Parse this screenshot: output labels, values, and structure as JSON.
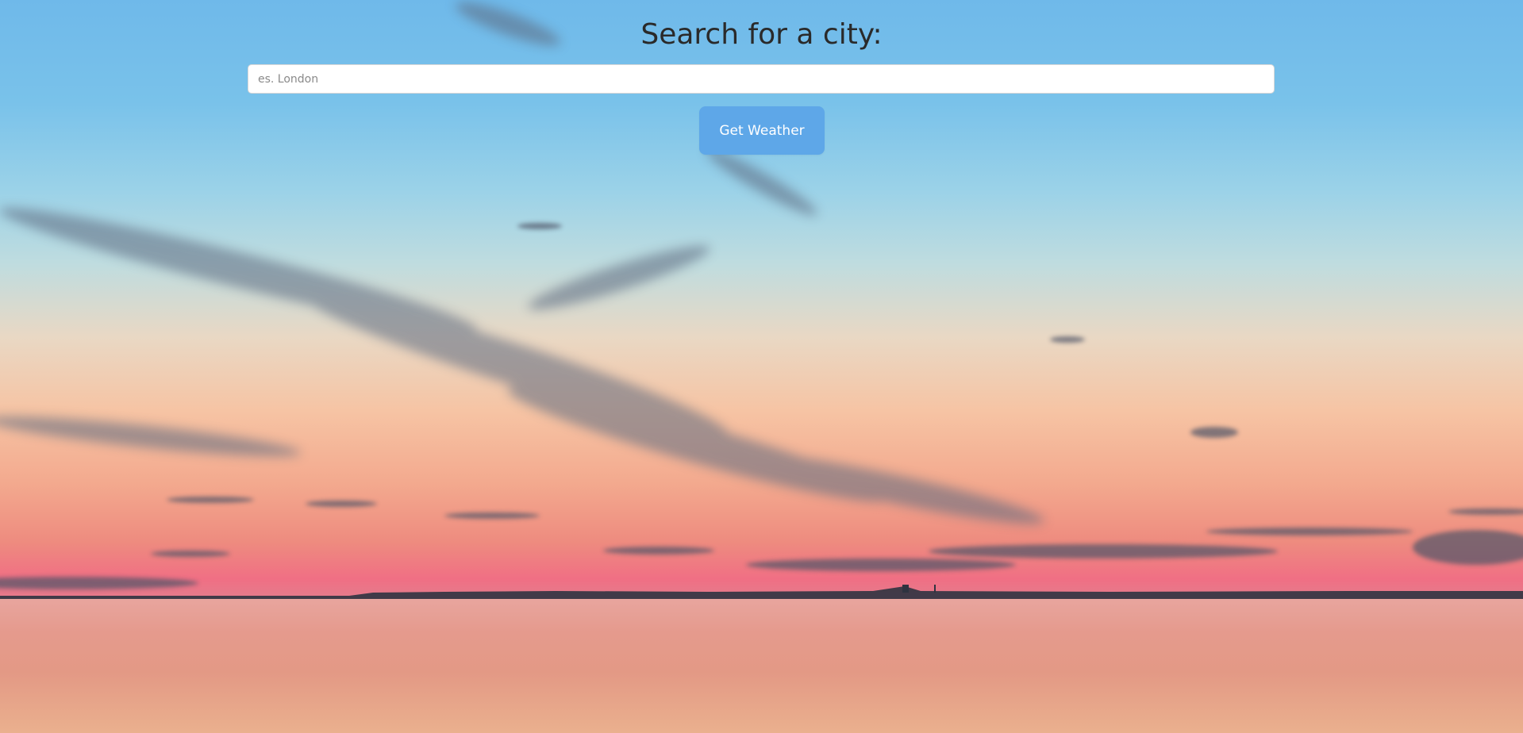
{
  "page": {
    "title": "Search for a city:"
  },
  "search": {
    "placeholder": "es. London",
    "value": ""
  },
  "actions": {
    "get_weather_label": "Get Weather"
  },
  "colors": {
    "button_background": "#5ea7e8",
    "button_text": "#ffffff",
    "title_text": "#2a2a2a",
    "input_background": "#ffffff"
  }
}
